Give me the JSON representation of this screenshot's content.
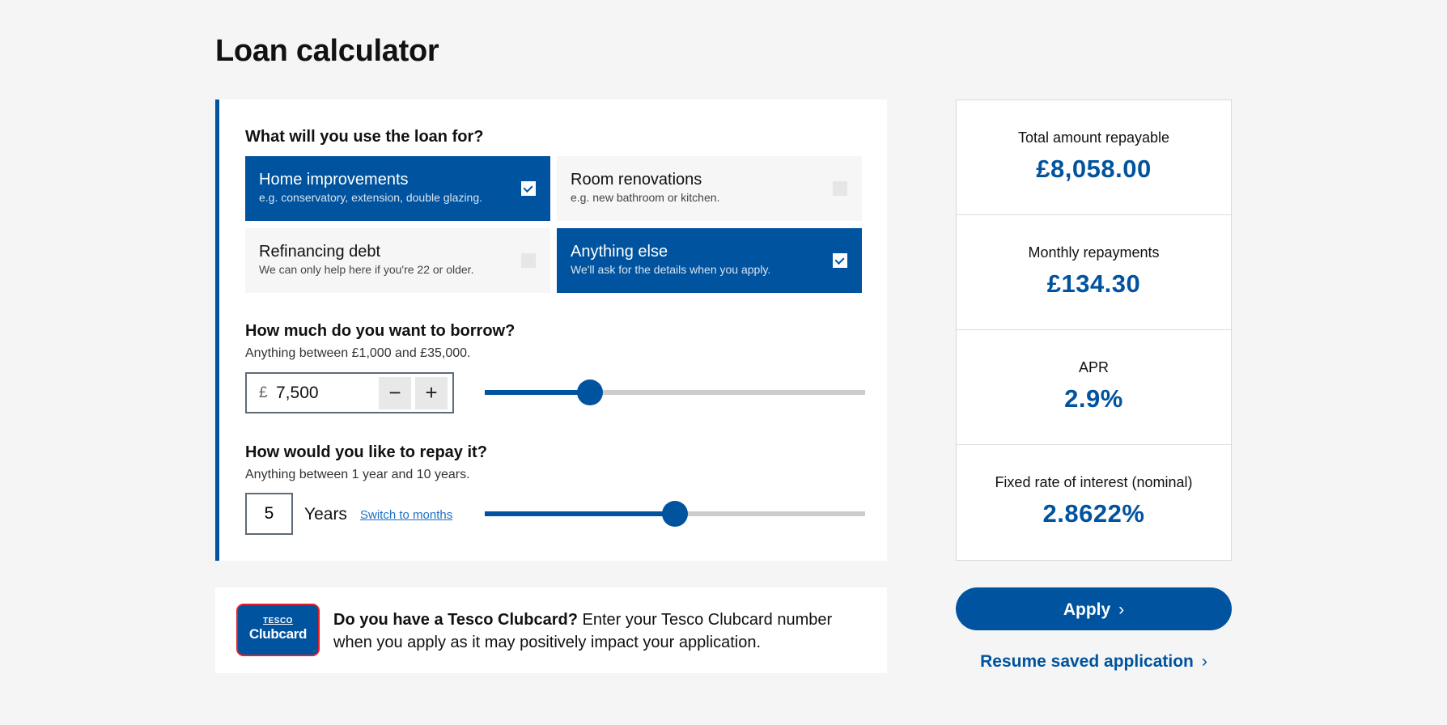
{
  "page": {
    "title": "Loan calculator"
  },
  "purpose": {
    "question": "What will you use the loan for?",
    "options": [
      {
        "title": "Home improvements",
        "subtitle": "e.g. conservatory, extension, double glazing.",
        "selected": true
      },
      {
        "title": "Room renovations",
        "subtitle": "e.g. new bathroom or kitchen.",
        "selected": false
      },
      {
        "title": "Refinancing debt",
        "subtitle": "We can only help here if you're 22 or older.",
        "selected": false
      },
      {
        "title": "Anything else",
        "subtitle": "We'll ask for the details when you apply.",
        "selected": true
      }
    ]
  },
  "borrow": {
    "question": "How much do you want to borrow?",
    "hint": "Anything between £1,000 and £35,000.",
    "currency_symbol": "£",
    "value": "7,500",
    "decrement_label": "−",
    "increment_label": "+",
    "slider_fraction": 0.277
  },
  "repay": {
    "question": "How would you like to repay it?",
    "hint": "Anything between 1 year and 10 years.",
    "value": "5",
    "unit": "Years",
    "switch_link": "Switch to months",
    "slider_fraction": 0.5
  },
  "clubcard": {
    "logo_top": "TESCO",
    "logo_bottom": "Clubcard",
    "bold_text": "Do you have a Tesco Clubcard?",
    "text": " Enter your Tesco Clubcard number when you apply as it may positively impact your application."
  },
  "summary": {
    "items": [
      {
        "label": "Total amount repayable",
        "value": "£8,058.00"
      },
      {
        "label": "Monthly repayments",
        "value": "£134.30"
      },
      {
        "label": "APR",
        "value": "2.9%"
      },
      {
        "label": "Fixed rate of interest (nominal)",
        "value": "2.8622%"
      }
    ]
  },
  "actions": {
    "apply_label": "Apply",
    "resume_label": "Resume saved application",
    "chevron_glyph": "›"
  },
  "colors": {
    "brand_blue": "#00539f",
    "clubcard_red": "#e0202a",
    "background": "#f5f5f5"
  }
}
